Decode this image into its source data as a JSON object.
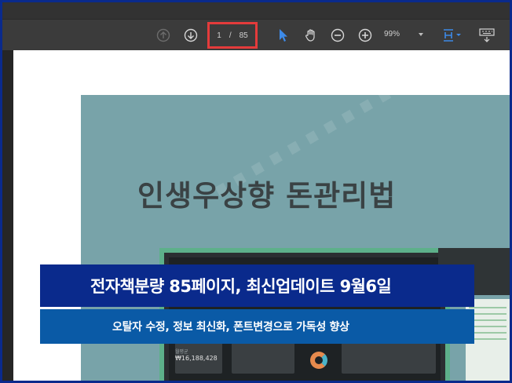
{
  "toolbar": {
    "current_page": "1",
    "page_separator": "/",
    "total_pages": "85",
    "zoom": "99%",
    "icons": [
      "page-up-icon",
      "page-down-icon",
      "select-cursor-icon",
      "hand-tool-icon",
      "zoom-out-icon",
      "zoom-in-icon",
      "page-fit-icon",
      "keyboard-icon"
    ],
    "accent": "#3d8ae8",
    "highlight": "#e43b3b"
  },
  "document": {
    "cover_title": "인생우상향 돈관리법",
    "balance_label": "월평균",
    "balance_value": "₩16,188,428"
  },
  "banner": {
    "headline": "전자책분량 85페이지, 최신업데이트 9월6일",
    "subline": "오탈자 수정, 정보 최신화, 폰트변경으로 가독성 향상",
    "headline_bg": "#0a2a8c",
    "subline_bg": "#0a5aa6"
  }
}
